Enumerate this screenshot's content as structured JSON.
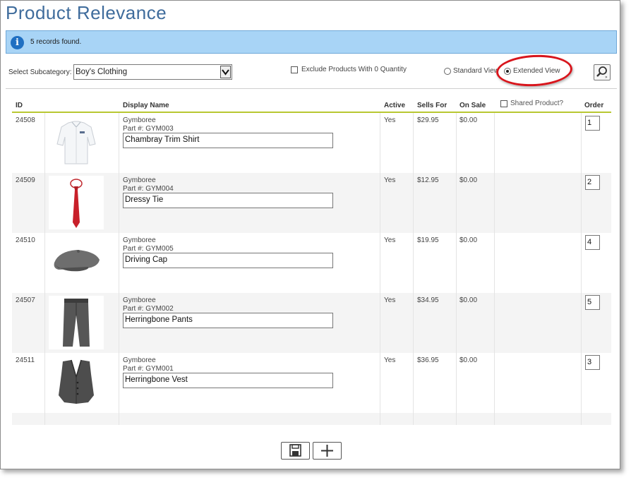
{
  "page": {
    "title": "Product Relevance"
  },
  "info": {
    "icon": "info-icon",
    "message": "5 records found."
  },
  "filters": {
    "subcategory_label": "Select Subcategory:",
    "subcategory_value": "Boy's Clothing",
    "exclude_label": "Exclude Products With 0 Quantity",
    "exclude_checked": false,
    "view_standard_label": "Standard View",
    "view_extended_label": "Extended View",
    "selected_view": "Extended View"
  },
  "table": {
    "headers": {
      "id": "ID",
      "display_name": "Display Name",
      "active": "Active",
      "sells_for": "Sells For",
      "on_sale": "On Sale",
      "shared": "Shared Product?",
      "order": "Order"
    },
    "rows": [
      {
        "id": "24508",
        "brand": "Gymboree",
        "part": "Part #: GYM003",
        "name": "Chambray Trim Shirt",
        "active": "Yes",
        "sells_for": "$29.95",
        "on_sale": "$0.00",
        "order": "1",
        "image": "shirt"
      },
      {
        "id": "24509",
        "brand": "Gymboree",
        "part": "Part #: GYM004",
        "name": "Dressy Tie",
        "active": "Yes",
        "sells_for": "$12.95",
        "on_sale": "$0.00",
        "order": "2",
        "image": "tie"
      },
      {
        "id": "24510",
        "brand": "Gymboree",
        "part": "Part #: GYM005",
        "name": "Driving Cap",
        "active": "Yes",
        "sells_for": "$19.95",
        "on_sale": "$0.00",
        "order": "4",
        "image": "cap"
      },
      {
        "id": "24507",
        "brand": "Gymboree",
        "part": "Part #: GYM002",
        "name": "Herringbone Pants",
        "active": "Yes",
        "sells_for": "$34.95",
        "on_sale": "$0.00",
        "order": "5",
        "image": "pants"
      },
      {
        "id": "24511",
        "brand": "Gymboree",
        "part": "Part #: GYM001",
        "name": "Herringbone Vest",
        "active": "Yes",
        "sells_for": "$36.95",
        "on_sale": "$0.00",
        "order": "3",
        "image": "vest"
      }
    ]
  },
  "footer": {
    "save_icon": "floppy-disk-icon",
    "add_icon": "plus-icon"
  },
  "colors": {
    "title": "#3f6c9c",
    "info_bg": "#a8d4f6",
    "header_rule": "#b8c732",
    "highlight_circle": "#d8151c"
  }
}
